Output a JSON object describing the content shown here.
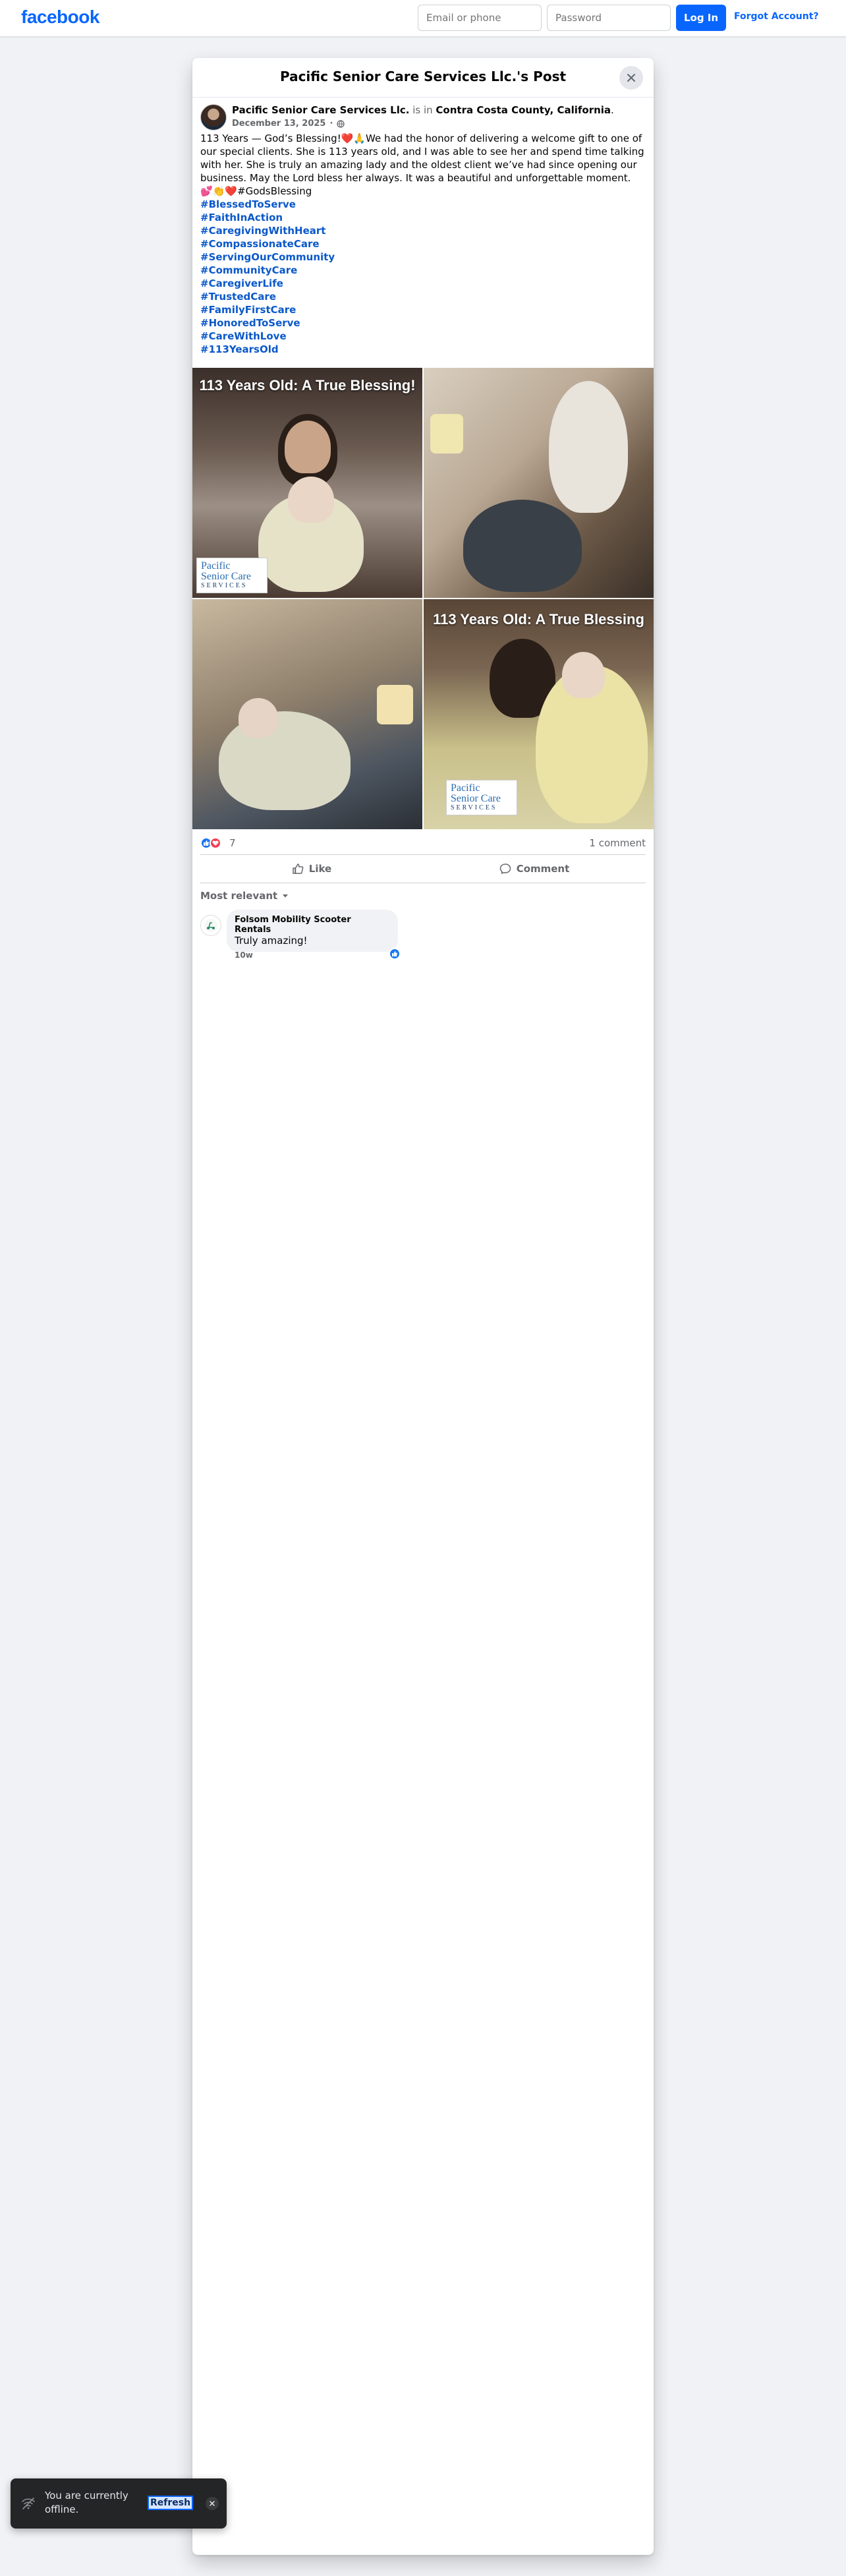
{
  "nav": {
    "logo": "facebook",
    "email_placeholder": "Email or phone",
    "password_placeholder": "Password",
    "login_label": "Log In",
    "forgot_label": "Forgot Account?"
  },
  "dialog": {
    "title": "Pacific Senior Care Services Llc.'s Post"
  },
  "post": {
    "author": "Pacific Senior Care Services Llc.",
    "is_in": "is in",
    "location": "Contra Costa County, California",
    "location_suffix": ".",
    "date": "December 13, 2025",
    "date_sep": "·",
    "body": "113 Years — God’s Blessing!❤️🙏We had the honor of delivering a welcome gift to one of our special clients. She is 113 years old, and I was able to see her and spend time talking with her. She is truly an amazing lady and the oldest client we’ve had since opening our business. May the Lord bless her always. It was a beautiful and unforgettable moment.",
    "emoji_line": "💕👏❤️#GodsBlessing",
    "hashtags": [
      "#BlessedToServe",
      "#FaithInAction",
      "#CaregivingWithHeart",
      "#CompassionateCare",
      "#ServingOurCommunity",
      "#CommunityCare",
      "#CaregiverLife",
      "#TrustedCare",
      "#FamilyFirstCare",
      "#HonoredToServe",
      "#CareWithLove",
      "#113YearsOld"
    ],
    "photos": [
      {
        "caption": "113 Years Old: A True Blessing!",
        "badge": true
      },
      {
        "caption": "",
        "badge": false
      },
      {
        "caption": "",
        "badge": false
      },
      {
        "caption": "113 Years Old: A True Blessing",
        "badge": true
      }
    ],
    "badge_line1": "Pacific",
    "badge_line2": "Senior Care",
    "badge_line3": "SERVICES",
    "reaction_count": "7",
    "comment_count": "1 comment",
    "like_label": "Like",
    "comment_label": "Comment"
  },
  "comments": {
    "sort_label": "Most relevant",
    "items": [
      {
        "author": "Folsom Mobility Scooter Rentals",
        "text": "Truly amazing!",
        "time": "10w"
      }
    ]
  },
  "toast": {
    "text": "You are currently offline.",
    "refresh_label": "Refresh"
  },
  "colors": {
    "brand": "#0866ff",
    "hashtag": "#0a58ca",
    "muted": "#65676b"
  }
}
